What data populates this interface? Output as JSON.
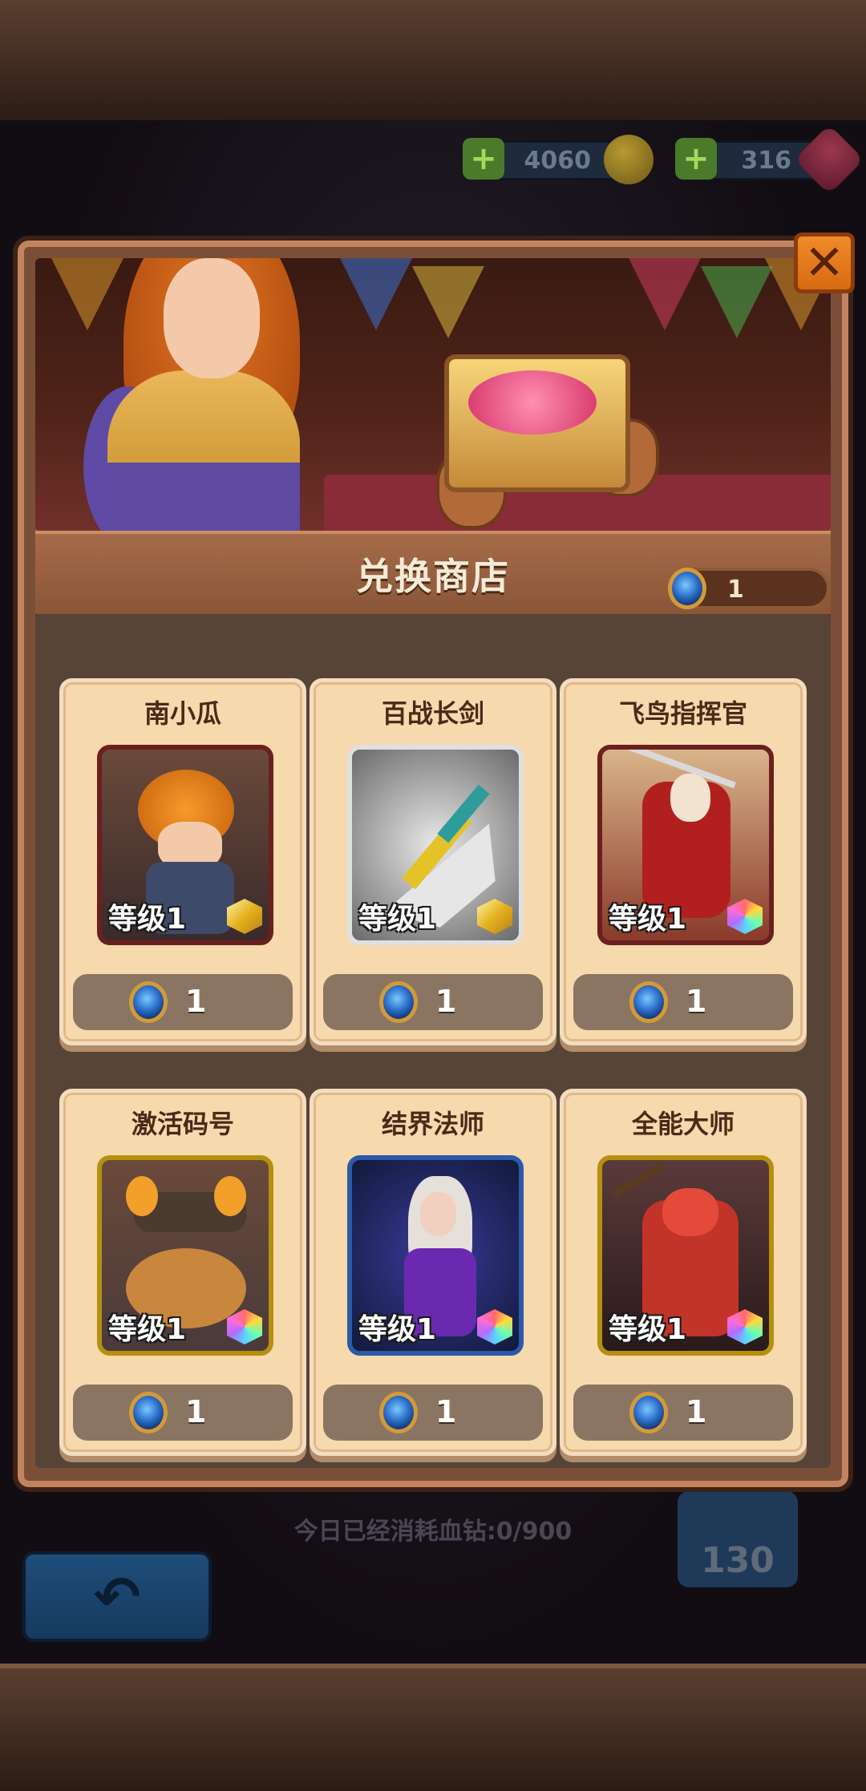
{
  "top_bar": {
    "coins": "4060",
    "gems": "316"
  },
  "shop": {
    "title": "兑换商店",
    "token_balance": "1"
  },
  "items": [
    {
      "name": "南小瓜",
      "level": "等级1",
      "price": "1"
    },
    {
      "name": "百战长剑",
      "level": "等级1",
      "price": "1"
    },
    {
      "name": "飞鸟指挥官",
      "level": "等级1",
      "price": "1"
    },
    {
      "name": "激活码号",
      "level": "等级1",
      "price": "1"
    },
    {
      "name": "结界法师",
      "level": "等级1",
      "price": "1"
    },
    {
      "name": "全能大师",
      "level": "等级1",
      "price": "1"
    }
  ],
  "background": {
    "daily_consumed": "今日已经消耗血钻:0/900",
    "badge_value": "130"
  },
  "colors": {
    "accent_orange": "#e07a1e",
    "card_bg": "#f7d9ae",
    "wood": "#7b4f37"
  }
}
